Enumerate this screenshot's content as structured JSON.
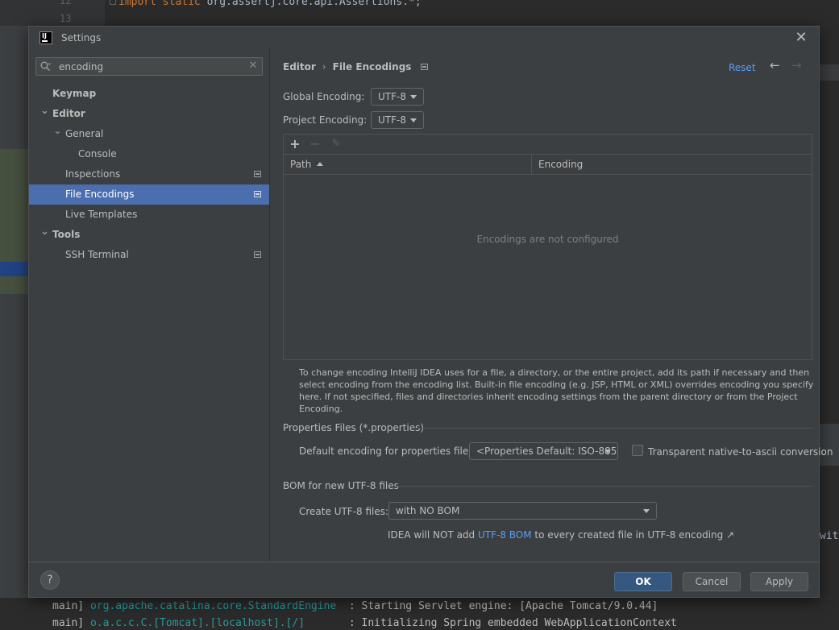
{
  "background": {
    "line_numbers": [
      "12",
      "13"
    ],
    "code_line": {
      "keyword": "import static",
      "rest": " org.assertj.core.api.Assertions.*;"
    },
    "right_text": "wit",
    "console": [
      {
        "prefix": "main] ",
        "logger": "org.apache.catalina.core.StandardEngine",
        "message": "  : Starting Servlet engine: [Apache Tomcat/9.0.44]"
      },
      {
        "prefix": "main] ",
        "logger": "o.a.c.c.C.[Tomcat].[localhost].[/]",
        "message": "       : Initializing Spring embedded WebApplicationContext"
      }
    ]
  },
  "dialog": {
    "title": "Settings",
    "app_icon_text": "IJ",
    "close_icon": "close-icon"
  },
  "search": {
    "value": "encoding",
    "clear_symbol": "✕"
  },
  "tree": {
    "items": [
      {
        "label": "Keymap",
        "level": 0,
        "bold": true,
        "arrow": "",
        "selected": false,
        "project_icon": false
      },
      {
        "label": "Editor",
        "level": 0,
        "bold": true,
        "arrow": "expanded",
        "selected": false,
        "project_icon": false
      },
      {
        "label": "General",
        "level": 1,
        "bold": false,
        "arrow": "expanded",
        "selected": false,
        "project_icon": false
      },
      {
        "label": "Console",
        "level": 2,
        "bold": false,
        "arrow": "",
        "selected": false,
        "project_icon": false
      },
      {
        "label": "Inspections",
        "level": 1,
        "bold": false,
        "arrow": "",
        "selected": false,
        "project_icon": true
      },
      {
        "label": "File Encodings",
        "level": 1,
        "bold": false,
        "arrow": "",
        "selected": true,
        "project_icon": true
      },
      {
        "label": "Live Templates",
        "level": 1,
        "bold": false,
        "arrow": "",
        "selected": false,
        "project_icon": false
      },
      {
        "label": "Tools",
        "level": 0,
        "bold": true,
        "arrow": "expanded",
        "selected": false,
        "project_icon": false
      },
      {
        "label": "SSH Terminal",
        "level": 1,
        "bold": false,
        "arrow": "",
        "selected": false,
        "project_icon": true
      }
    ]
  },
  "breadcrumb": {
    "parent": "Editor",
    "separator": "›",
    "current": "File Encodings"
  },
  "header": {
    "reset_label": "Reset",
    "back_symbol": "←",
    "forward_symbol": "→"
  },
  "global_encoding": {
    "label": "Global Encoding:",
    "value": "UTF-8"
  },
  "project_encoding": {
    "label": "Project Encoding:",
    "value": "UTF-8"
  },
  "table": {
    "toolbar": {
      "add": "+",
      "remove": "−",
      "edit": "✎"
    },
    "columns": [
      "Path",
      "Encoding"
    ],
    "sort_column": "Path",
    "empty_text": "Encodings are not configured"
  },
  "help_text": "To change encoding IntelliJ IDEA uses for a file, a directory, or the entire project, add its path if necessary and then select encoding from the encoding list. Built-in file encoding (e.g. JSP, HTML or XML) overrides encoding you specify here. If not specified, files and directories inherit encoding settings from the parent directory or from the Project Encoding.",
  "properties": {
    "section_title": "Properties Files (*.properties)",
    "default_label": "Default encoding for properties files:",
    "default_value": "<Properties Default: ISO-885...",
    "transparent_label": "Transparent native-to-ascii conversion",
    "transparent_checked": false
  },
  "bom": {
    "section_title": "BOM for new UTF-8 files",
    "create_label": "Create UTF-8 files:",
    "create_value": "with NO BOM",
    "note_before": "IDEA will NOT add ",
    "note_link": "UTF-8 BOM",
    "note_after": " to every created file in UTF-8 encoding ↗"
  },
  "footer": {
    "help_symbol": "?",
    "ok_label": "OK",
    "cancel_label": "Cancel",
    "apply_label": "Apply"
  },
  "colors": {
    "accent": "#4b6eaf",
    "link": "#589df6",
    "ok_button": "#365880",
    "panel": "#3c3f41"
  }
}
